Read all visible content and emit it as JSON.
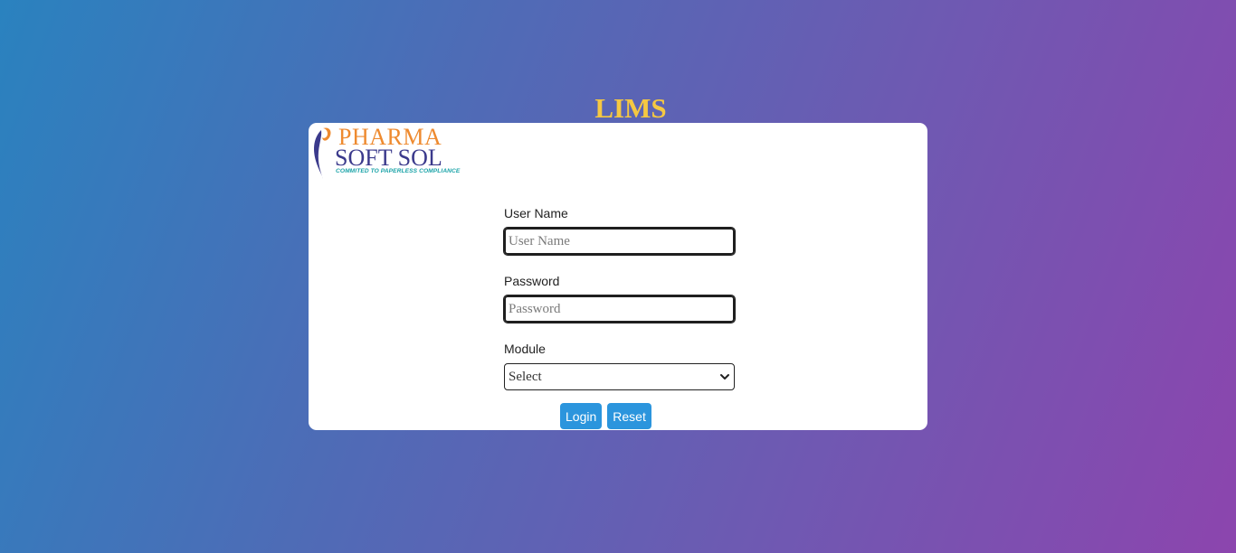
{
  "app": {
    "title": "LIMS"
  },
  "logo": {
    "line1": "PHARMA",
    "line2": "SOFT SOL",
    "tagline": "COMMITED TO PAPERLESS COMPLIANCE",
    "colors": {
      "orange": "#ee8a2f",
      "navy": "#3b3a8c",
      "teal": "#1aa3a8"
    }
  },
  "form": {
    "username": {
      "label": "User Name",
      "placeholder": "User Name",
      "value": ""
    },
    "password": {
      "label": "Password",
      "placeholder": "Password",
      "value": ""
    },
    "module": {
      "label": "Module",
      "selected": "Select"
    }
  },
  "buttons": {
    "login": "Login",
    "reset": "Reset"
  },
  "colors": {
    "title": "#f5c842",
    "button": "#2b95dd",
    "gradient_start": "#2a82bf",
    "gradient_end": "#8c45ae"
  }
}
